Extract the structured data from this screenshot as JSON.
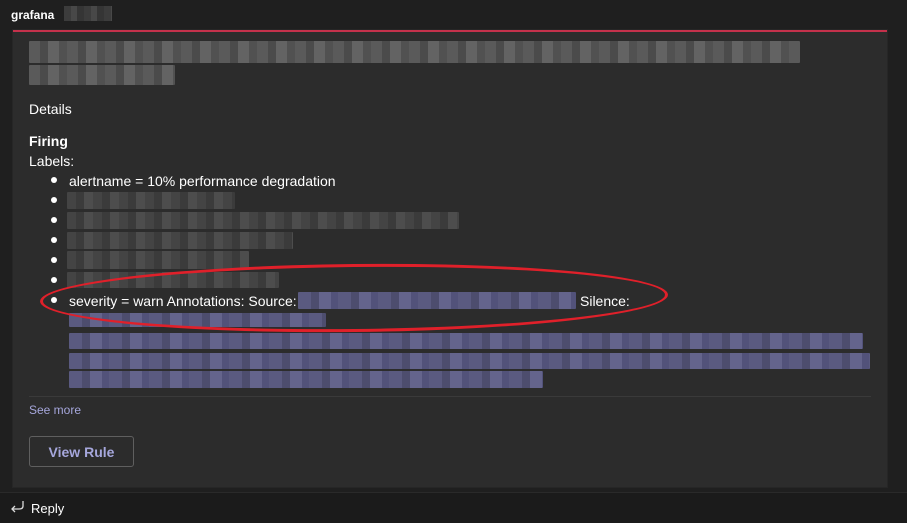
{
  "message": {
    "sender": "grafana"
  },
  "card": {
    "accent_color": "#c4314b",
    "details_label": "Details",
    "status_label": "Firing",
    "labels_title": "Labels:",
    "labels": [
      "alertname = 10% performance degradation"
    ],
    "severity_line": "severity = warn Annotations: Source:",
    "silence_label": "Silence:",
    "see_more_label": "See more",
    "view_rule_label": "View Rule",
    "highlight_color": "#e0202a"
  },
  "footer": {
    "reply_label": "Reply",
    "reply_icon": "reply-arrow-icon"
  }
}
